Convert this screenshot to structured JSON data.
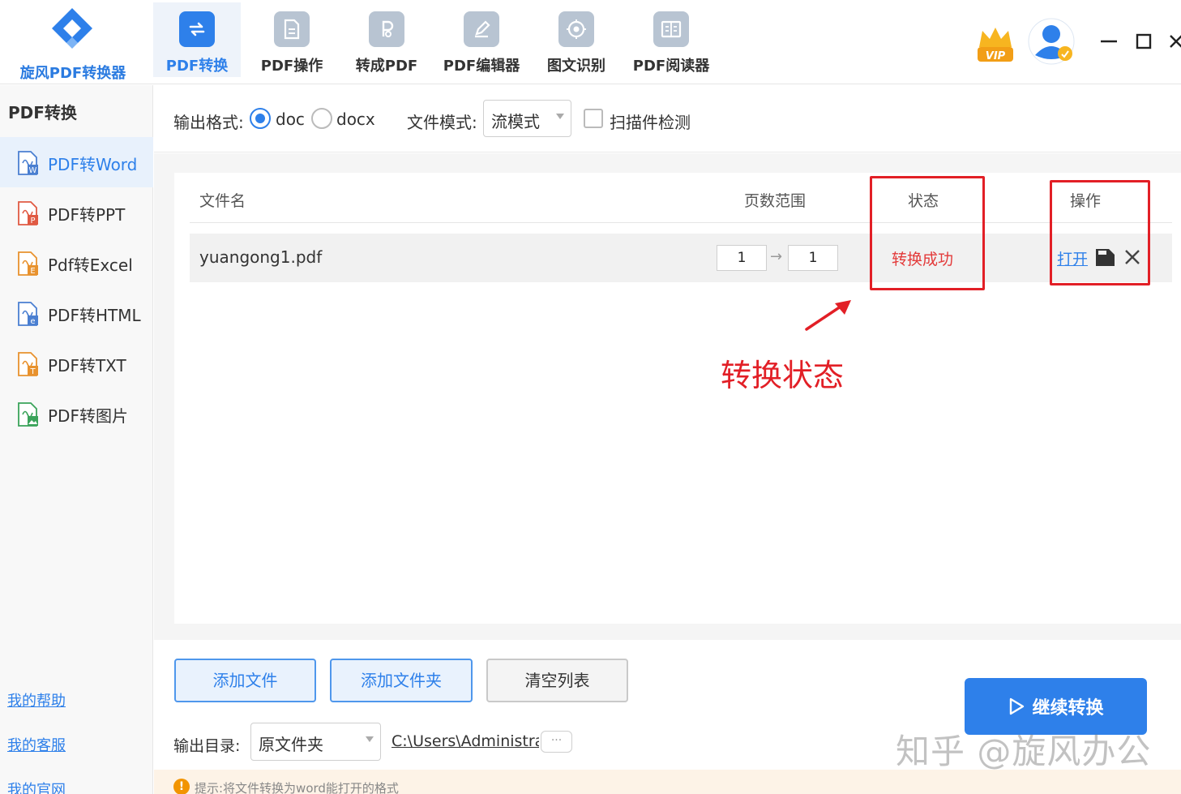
{
  "brand": {
    "name": "旋风PDF转换器"
  },
  "top_tabs": [
    {
      "label": "PDF转换",
      "icon": "convert-arrows-icon"
    },
    {
      "label": "PDF操作",
      "icon": "document-icon"
    },
    {
      "label": "转成PDF",
      "icon": "pdf-file-icon"
    },
    {
      "label": "PDF编辑器",
      "icon": "pencil-icon"
    },
    {
      "label": "图文识别",
      "icon": "target-icon"
    },
    {
      "label": "PDF阅读器",
      "icon": "book-icon"
    }
  ],
  "header_icons": [
    "vip-crown-icon",
    "user-avatar-icon",
    "minimize-icon",
    "maximize-icon",
    "close-icon"
  ],
  "sidebar": {
    "title": "PDF转换",
    "items": [
      {
        "label": "PDF转Word",
        "icon": "word-file-icon"
      },
      {
        "label": "PDF转PPT",
        "icon": "ppt-file-icon"
      },
      {
        "label": "Pdf转Excel",
        "icon": "excel-file-icon"
      },
      {
        "label": "PDF转HTML",
        "icon": "html-file-icon"
      },
      {
        "label": "PDF转TXT",
        "icon": "txt-file-icon"
      },
      {
        "label": "PDF转图片",
        "icon": "image-file-icon"
      }
    ],
    "links": [
      "我的帮助",
      "我的客服",
      "我的官网"
    ]
  },
  "options": {
    "format_label": "输出格式:",
    "format_options": [
      "doc",
      "docx"
    ],
    "format_selected": "doc",
    "mode_label": "文件模式:",
    "mode_value": "流模式",
    "scan_label": "扫描件检测",
    "scan_checked": false
  },
  "table": {
    "headers": {
      "name": "文件名",
      "pages": "页数范围",
      "status": "状态",
      "action": "操作"
    },
    "rows": [
      {
        "name": "yuangong1.pdf",
        "page_from": "1",
        "page_to": "1",
        "status": "转换成功",
        "open": "打开"
      }
    ]
  },
  "annotation": {
    "text": "转换状态",
    "color": "#e21f26"
  },
  "buttons": {
    "add_file": "添加文件",
    "add_folder": "添加文件夹",
    "clear_list": "清空列表",
    "convert": "继续转换"
  },
  "output": {
    "label": "输出目录:",
    "dir_option": "原文件夹",
    "path": "C:\\Users\\Administrator",
    "browse": "···"
  },
  "tip": {
    "text": "提示:将文件转换为word能打开的格式"
  },
  "watermark": "知乎 @旋风办公",
  "colors": {
    "accent": "#2e80ea",
    "status_success": "#e33a3a",
    "highlight_box": "#e21f26"
  }
}
